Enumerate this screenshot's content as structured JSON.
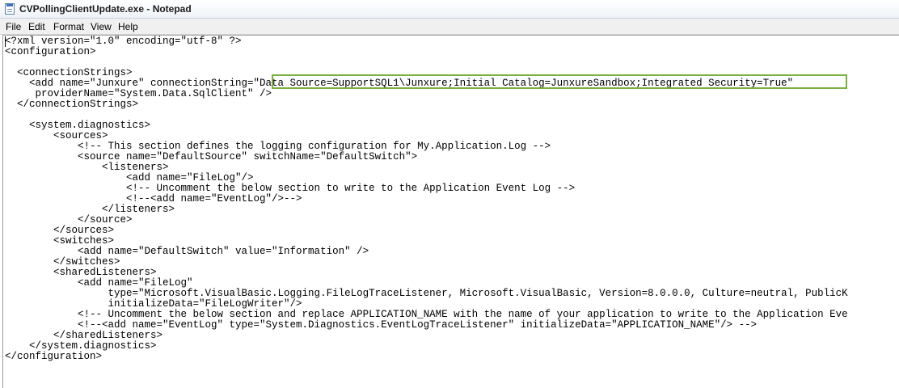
{
  "window": {
    "title": "CVPollingClientUpdate.exe - Notepad",
    "icon": "notepad-icon"
  },
  "menu": {
    "items": [
      "File",
      "Edit",
      "Format",
      "View",
      "Help"
    ]
  },
  "editor": {
    "lines": [
      "<?xml version=\"1.0\" encoding=\"utf-8\" ?>",
      "<configuration>",
      "",
      "  <connectionStrings>",
      "    <add name=\"Junxure\" connectionString=\"Data Source=SupportSQL1\\Junxure;Initial Catalog=JunxureSandbox;Integrated Security=True\"",
      "     providerName=\"System.Data.SqlClient\" />",
      "  </connectionStrings>",
      "",
      "    <system.diagnostics>",
      "        <sources>",
      "            <!-- This section defines the logging configuration for My.Application.Log -->",
      "            <source name=\"DefaultSource\" switchName=\"DefaultSwitch\">",
      "                <listeners>",
      "                    <add name=\"FileLog\"/>",
      "                    <!-- Uncomment the below section to write to the Application Event Log -->",
      "                    <!--<add name=\"EventLog\"/>-->",
      "                </listeners>",
      "            </source>",
      "        </sources>",
      "        <switches>",
      "            <add name=\"DefaultSwitch\" value=\"Information\" />",
      "        </switches>",
      "        <sharedListeners>",
      "            <add name=\"FileLog\"",
      "                 type=\"Microsoft.VisualBasic.Logging.FileLogTraceListener, Microsoft.VisualBasic, Version=8.0.0.0, Culture=neutral, PublicK",
      "                 initializeData=\"FileLogWriter\"/>",
      "            <!-- Uncomment the below section and replace APPLICATION_NAME with the name of your application to write to the Application Eve",
      "            <!--<add name=\"EventLog\" type=\"System.Diagnostics.EventLogTraceListener\" initializeData=\"APPLICATION_NAME\"/> -->",
      "        </sharedListeners>",
      "    </system.diagnostics>",
      "</configuration>"
    ]
  },
  "annotation": {
    "color": "#7ab043"
  }
}
